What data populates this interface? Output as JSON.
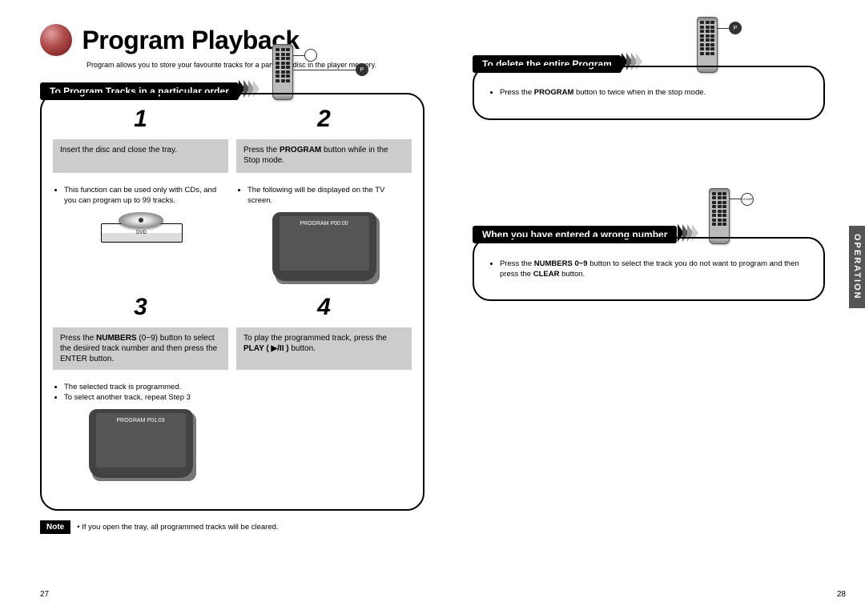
{
  "header": {
    "title": "Program Playback",
    "subtitle": "Program allows you to store your favourite tracks for a particular disc in the player memory."
  },
  "side_tab": "OPERATION",
  "page_left": "27",
  "page_right": "28",
  "left": {
    "banner": "To Program Tracks in a particular order",
    "step1": {
      "num": "1",
      "grey": "Insert the disc and close the tray.",
      "note": "This function can be used only with CDs, and you can program up to 99 tracks."
    },
    "step2": {
      "num": "2",
      "grey_a": "Press the ",
      "grey_b": "PROGRAM",
      "grey_c": " button while in the Stop mode.",
      "note": "The following will be displayed on the TV screen.",
      "tv_text": "PROGRAM  P00:00"
    },
    "step3": {
      "num": "3",
      "grey_a": "Press the ",
      "grey_b": "NUMBERS",
      "grey_c": " (0~9) button to select the desired track number and then press the ENTER button.",
      "note1": "The selected track is programmed.",
      "note2": "To select another track, repeat Step 3",
      "tv_text": "PROGRAM  P01:03"
    },
    "step4": {
      "num": "4",
      "grey_a": "To play the programmed track, press the ",
      "grey_b": "PLAY ( ▶/II  )",
      "grey_c": " button."
    }
  },
  "note_bottom": {
    "label": "Note",
    "text": "If you open the tray, all programmed tracks will be cleared."
  },
  "right": {
    "sec1": {
      "banner": "To delete the entire Program",
      "text_a": "Press the ",
      "text_b": "PROGRAM",
      "text_c": " button to twice when in the stop mode."
    },
    "sec2": {
      "banner": "When you have entered a wrong number",
      "text_a": "Press the ",
      "text_b": "NUMBERS 0~9",
      "text_c": " button to select the track you do not want to program and then press the ",
      "text_d": "CLEAR",
      "text_e": " button.",
      "callout_btn": "CLEAR"
    }
  }
}
